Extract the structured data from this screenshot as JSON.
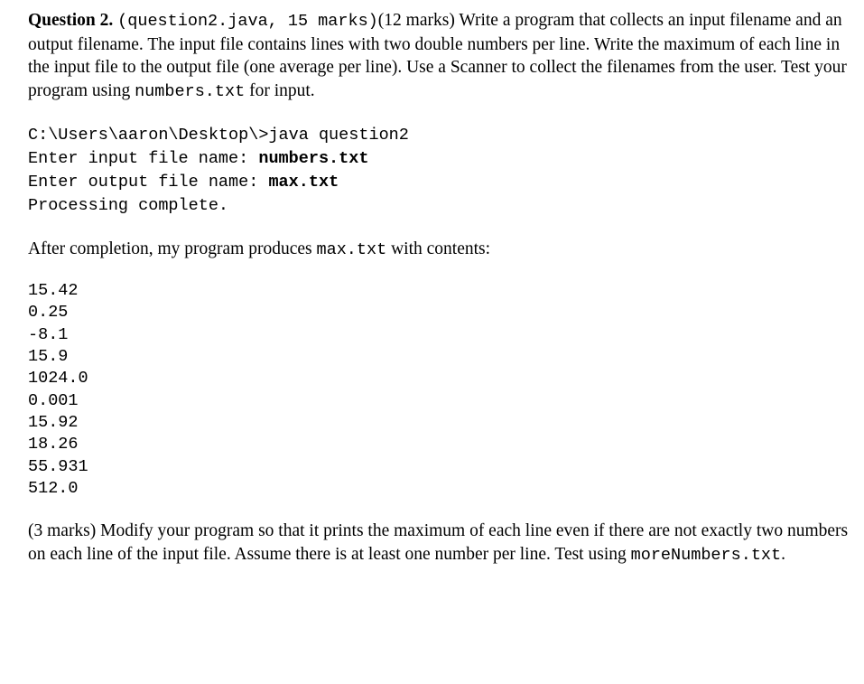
{
  "document": {
    "question": {
      "label": "Question 2.",
      "file_spec": "(question2.java, 15 marks)",
      "marks_inline": "(12 marks)",
      "body_part1": " Write a program that collects an input filename and an output filename.  The input file contains lines with two double numbers per line.  Write the maximum of each line in the input file to the output file (one average per line).  Use a Scanner to collect the filenames from the user.  Test your program using ",
      "input_file": "numbers.txt",
      "body_part2": " for input."
    },
    "console": {
      "line1_prompt": "C:\\Users\\aaron\\Desktop\\>java question2",
      "line2_label": "Enter input file name: ",
      "line2_value": "numbers.txt",
      "line3_label": "Enter output file name: ",
      "line3_value": "max.txt",
      "line4": "Processing complete."
    },
    "after_completion": {
      "text_before": "After completion, my program produces ",
      "file": "max.txt",
      "text_after": " with contents:"
    },
    "output_values": [
      "15.42",
      "0.25",
      "-8.1",
      "15.9",
      "1024.0",
      "0.001",
      "15.92",
      "18.26",
      "55.931",
      "512.0"
    ],
    "closing": {
      "marks": "(3 marks)",
      "text_before": "  Modify your program so that it prints the maximum of each line even if there are not exactly two numbers on each line of the input file.  Assume there is at least one number per line.  Test using ",
      "file": "moreNumbers.txt",
      "text_after": "."
    }
  }
}
